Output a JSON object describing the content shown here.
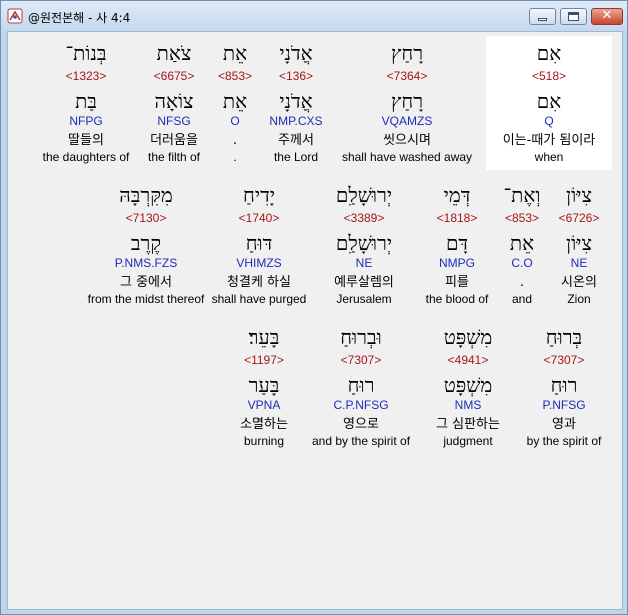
{
  "window": {
    "title": "@원전본해 - 사 4:4",
    "minimize_label": "_",
    "maximize_label": "□",
    "close_label": "✕"
  },
  "colors": {
    "strong": "#a5161a",
    "parse": "#1d2db9",
    "highlight": "#ffffff"
  },
  "rows": [
    {
      "words": [
        {
          "hebrew": "בְּנוֹת־",
          "strong": "<1323>",
          "lemma": "בַּת",
          "parse": "NFPG",
          "korean": "딸들의",
          "english": "the daughters of"
        },
        {
          "hebrew": "צֹאַת",
          "strong": "<6675>",
          "lemma": "צוֹאָה",
          "parse": "NFSG",
          "korean": "더러움을",
          "english": "the filth of"
        },
        {
          "hebrew": "אֵת",
          "strong": "<853>",
          "lemma": "אֵת",
          "parse": "O",
          "korean": ".",
          "english": "."
        },
        {
          "hebrew": "אֲדֹנָי",
          "strong": "<136>",
          "lemma": "אֲדֹנָי",
          "parse": "NMP.CXS",
          "korean": "주께서",
          "english": "the Lord"
        },
        {
          "hebrew": "רָחַץ",
          "strong": "<7364>",
          "lemma": "רָחַץ",
          "parse": "VQAMZS",
          "korean": "씻으시며",
          "english": "shall have washed away"
        },
        {
          "hebrew": "אִם",
          "strong": "<518>",
          "lemma": "אִם",
          "parse": "Q",
          "korean": "이는-때가 됨이라",
          "english": "when",
          "highlight": true
        }
      ]
    },
    {
      "words": [
        {
          "hebrew": "מִקִּרְבָּהּ",
          "strong": "<7130>",
          "lemma": "קֶרֶב",
          "parse": "P.NMS.FZS",
          "korean": "그 중에서",
          "english": "from the midst thereof"
        },
        {
          "hebrew": "יָדִיחַ",
          "strong": "<1740>",
          "lemma": "דּוּחַ",
          "parse": "VHIMZS",
          "korean": "청결케 하실",
          "english": "shall have purged"
        },
        {
          "hebrew": "יְרוּשָׁלִַם",
          "strong": "<3389>",
          "lemma": "יְרוּשָׁלִַם",
          "parse": "NE",
          "korean": "예루살렘의",
          "english": "Jerusalem"
        },
        {
          "hebrew": "דְּמֵי",
          "strong": "<1818>",
          "lemma": "דָּם",
          "parse": "NMPG",
          "korean": "피를",
          "english": "the blood of"
        },
        {
          "hebrew": "וְאֶת־",
          "strong": "<853>",
          "lemma": "אֵת",
          "parse": "C.O",
          "korean": ".",
          "english": "and"
        },
        {
          "hebrew": "צִיּוֹן",
          "strong": "<6726>",
          "lemma": "צִיּוֹן",
          "parse": "NE",
          "korean": "시온의",
          "english": "Zion"
        }
      ]
    },
    {
      "words": [
        {
          "hebrew": "בָּעֵר׃",
          "strong": "<1197>",
          "lemma": "בָּעַר",
          "parse": "VPNA",
          "korean": "소멸하는",
          "english": "burning"
        },
        {
          "hebrew": "וּבְרוּחַ",
          "strong": "<7307>",
          "lemma": "רוּחַ",
          "parse": "C.P.NFSG",
          "korean": "영으로",
          "english": "and by the spirit of"
        },
        {
          "hebrew": "מִשְׁפָּט",
          "strong": "<4941>",
          "lemma": "מִשְׁפָּט",
          "parse": "NMS",
          "korean": "그 심판하는",
          "english": "judgment"
        },
        {
          "hebrew": "בְּרוּחַ",
          "strong": "<7307>",
          "lemma": "רוּחַ",
          "parse": "P.NFSG",
          "korean": "영과",
          "english": "by the spirit of"
        }
      ]
    }
  ]
}
